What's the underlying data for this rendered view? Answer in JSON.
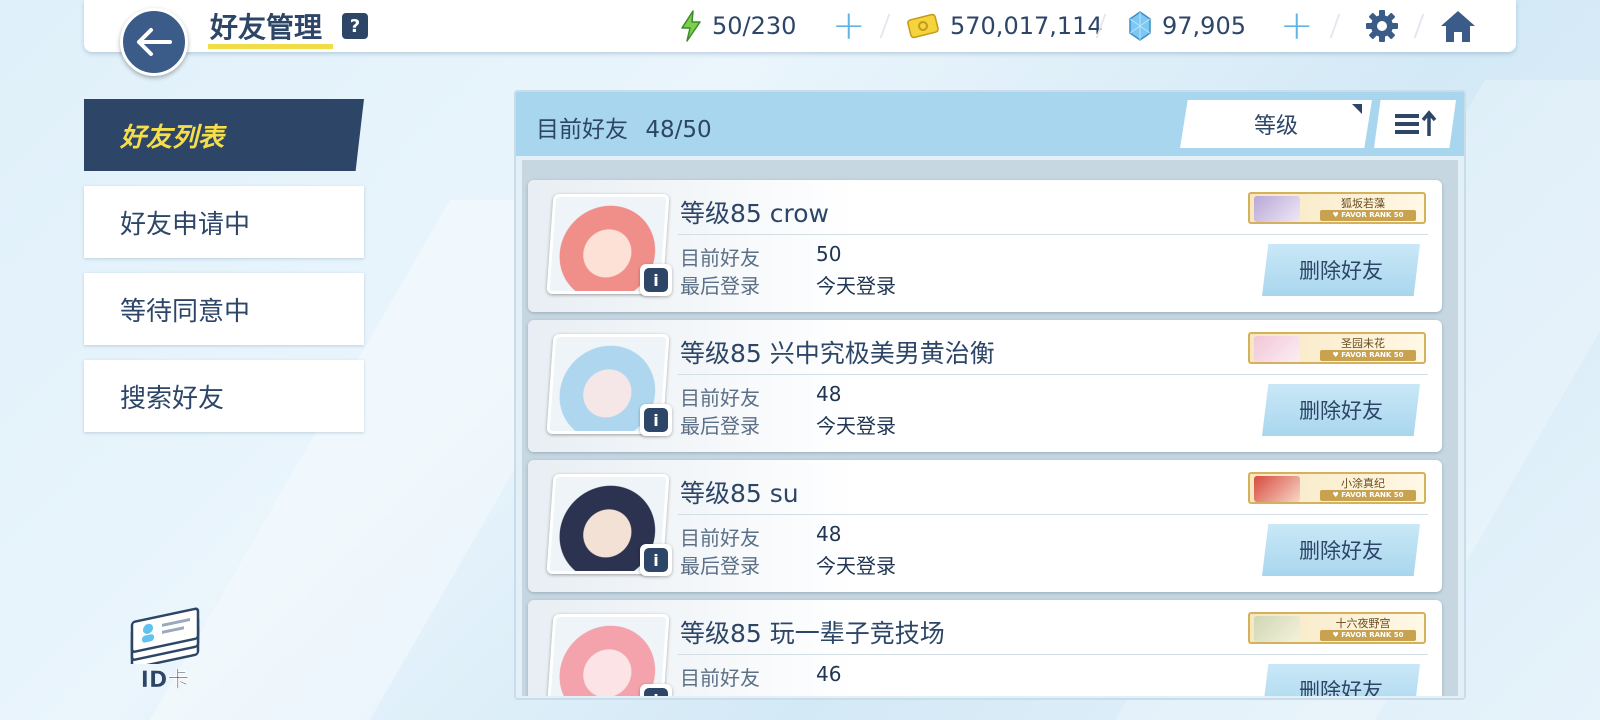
{
  "header": {
    "title": "好友管理",
    "help_label": "?",
    "ap": "50/230",
    "credits": "570,017,114",
    "gems": "97,905",
    "icons": {
      "back": "back-arrow-icon",
      "ap": "lightning-icon",
      "credits": "credit-card-icon",
      "gems": "crystal-icon",
      "settings": "gear-icon",
      "home": "home-icon"
    }
  },
  "sidebar": {
    "items": [
      {
        "label": "好友列表",
        "active": true
      },
      {
        "label": "好友申请中",
        "active": false
      },
      {
        "label": "等待同意中",
        "active": false
      },
      {
        "label": "搜索好友",
        "active": false
      }
    ],
    "id_card_label": "ID卡"
  },
  "panel": {
    "count_label": "目前好友",
    "count_value": "48/50",
    "sort_label": "等级",
    "friends_label": "目前好友",
    "last_login_label": "最后登录",
    "delete_label": "删除好友",
    "favor_rank_text": "♥ FAVOR RANK 50",
    "info_label": "i"
  },
  "friends": [
    {
      "name": "等级85 crow",
      "friends": "50",
      "last_login": "今天登录",
      "fav_student": "狐坂若藻",
      "avatar_colors": [
        "#f08f8a",
        "#fde0d6"
      ],
      "fav_colors": [
        "#b9a7d6",
        "#efe8f6"
      ]
    },
    {
      "name": "等级85 兴中究极美男黄治衡",
      "friends": "48",
      "last_login": "今天登录",
      "fav_student": "圣园未花",
      "avatar_colors": [
        "#aed7ef",
        "#f5e6e8"
      ],
      "fav_colors": [
        "#f2c6d8",
        "#fbeef3"
      ]
    },
    {
      "name": "等级85 su",
      "friends": "48",
      "last_login": "今天登录",
      "fav_student": "小涂真纪",
      "avatar_colors": [
        "#2c3350",
        "#f4e1d6"
      ],
      "fav_colors": [
        "#d84a3e",
        "#f7d7c9"
      ]
    },
    {
      "name": "等级85 玩一辈子竞技场",
      "friends": "46",
      "last_login": "",
      "fav_student": "十六夜野宫",
      "avatar_colors": [
        "#f4a2ac",
        "#fbe3e6"
      ],
      "fav_colors": [
        "#cfd7b4",
        "#f4f1dc"
      ]
    }
  ],
  "colors": {
    "navy": "#2d4667",
    "accent_yellow": "#f1dd47",
    "plus_blue": "#5fb6e6",
    "panel_header": "#a8d6ee"
  }
}
